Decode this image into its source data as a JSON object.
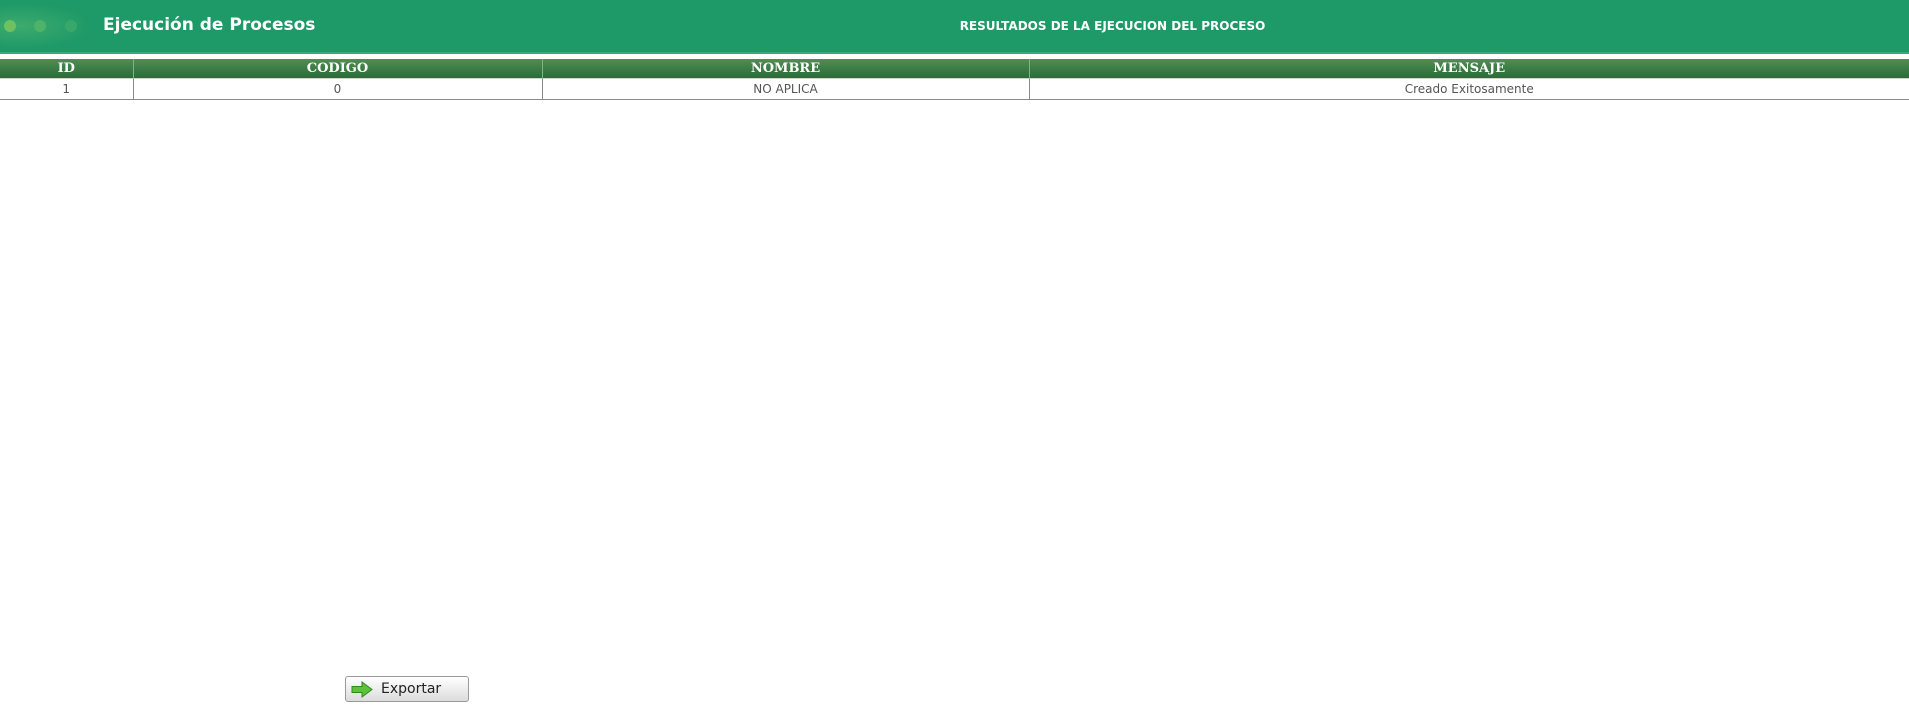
{
  "header": {
    "app_title": "Ejecución de Procesos",
    "page_heading": "RESULTADOS DE LA EJECUCION DEL PROCESO",
    "accent_color": "#1e9a68"
  },
  "table": {
    "columns": [
      "ID",
      "CODIGO",
      "NOMBRE",
      "MENSAJE"
    ],
    "rows": [
      [
        "1",
        "0",
        "NO APLICA",
        "Creado Exitosamente"
      ]
    ]
  },
  "footer": {
    "export_label": "Exportar",
    "export_icon": "green-arrow-right-icon"
  }
}
